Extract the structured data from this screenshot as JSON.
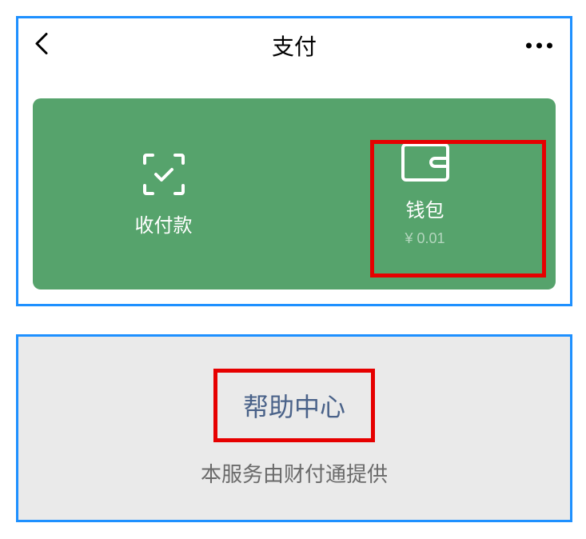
{
  "header": {
    "title": "支付"
  },
  "actions": {
    "pay_receive": {
      "label": "收付款"
    },
    "wallet": {
      "label": "钱包",
      "balance": "¥ 0.01"
    }
  },
  "footer": {
    "help_center": "帮助中心",
    "provider": "本服务由财付通提供"
  },
  "highlights": {
    "wallet_box": true,
    "help_box": true
  },
  "colors": {
    "card_green": "#56a36c",
    "highlight_red": "#e60000",
    "panel_border_blue": "#1e90ff",
    "help_link": "#4a6289"
  }
}
